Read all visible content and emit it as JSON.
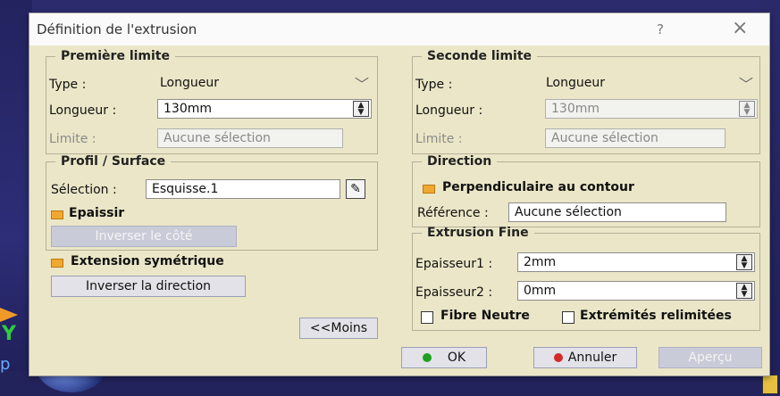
{
  "dialog": {
    "title": "Définition de l'extrusion",
    "help_symbol": "?",
    "close_symbol": "×"
  },
  "premiere_limite": {
    "title": "Première limite",
    "type_label": "Type :",
    "type_value": "Longueur",
    "longueur_label": "Longueur :",
    "longueur_value": "130mm",
    "limite_label": "Limite :",
    "limite_value": "Aucune sélection"
  },
  "seconde_limite": {
    "title": "Seconde limite",
    "type_label": "Type :",
    "type_value": "Longueur",
    "longueur_label": "Longueur :",
    "longueur_value": "130mm",
    "limite_label": "Limite :",
    "limite_value": "Aucune sélection"
  },
  "profil": {
    "title": "Profil / Surface",
    "selection_label": "Sélection :",
    "selection_value": "Esquisse.1",
    "epaissir_label": "Epaissir",
    "inverser_cote_label": "Inverser le côté"
  },
  "direction": {
    "title": "Direction",
    "perpendiculaire_label": "Perpendiculaire au contour",
    "reference_label": "Référence :",
    "reference_value": "Aucune sélection"
  },
  "extrusion_fine": {
    "title": "Extrusion Fine",
    "epaisseur1_label": "Epaisseur1 :",
    "epaisseur1_value": "2mm",
    "epaisseur2_label": "Epaisseur2 :",
    "epaisseur2_value": "0mm",
    "fibre_neutre_label": "Fibre Neutre",
    "extremites_label": "Extrémités relimitées"
  },
  "options": {
    "extension_symetrique_label": "Extension symétrique",
    "inverser_direction_label": "Inverser la direction",
    "moins_label": "<<Moins"
  },
  "footer": {
    "ok_label": "OK",
    "annuler_label": "Annuler",
    "apercu_label": "Aperçu"
  },
  "background": {
    "axis_y": "Y",
    "axis_p": "p"
  },
  "colors": {
    "dialog_bg": "#ebe6c7",
    "ok_indicator": "#1ea01e",
    "cancel_indicator": "#d42a2a",
    "checkbox_on": "#f0a830"
  }
}
